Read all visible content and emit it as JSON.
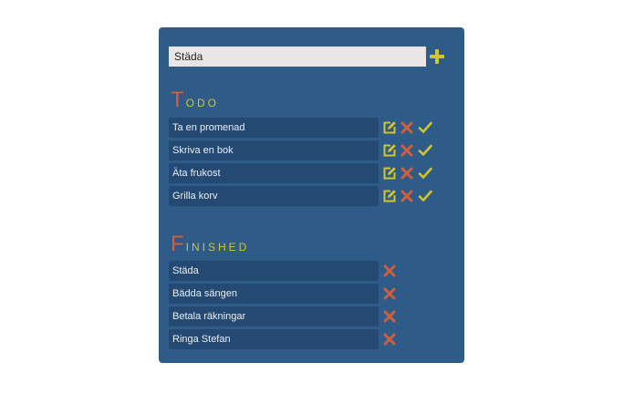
{
  "colors": {
    "panel_background": "#2e5b87",
    "item_background": "#244a73",
    "accent_yellow": "#d4c52c",
    "accent_red": "#d35f3a"
  },
  "input": {
    "value": "Städa",
    "add_icon": "plus-icon"
  },
  "todo": {
    "title_first": "T",
    "title_rest": "odo",
    "items": [
      {
        "label": "Ta en promenad"
      },
      {
        "label": "Skriva en bok"
      },
      {
        "label": "Äta frukost"
      },
      {
        "label": "Grilla korv"
      }
    ],
    "icons": [
      "edit-icon",
      "delete-icon",
      "checkmark-icon"
    ]
  },
  "finished": {
    "title_first": "F",
    "title_rest": "inished",
    "items": [
      {
        "label": "Städa"
      },
      {
        "label": "Bädda sängen"
      },
      {
        "label": "Betala räkningar"
      },
      {
        "label": "Ringa Stefan"
      }
    ],
    "icons": [
      "delete-icon"
    ]
  }
}
